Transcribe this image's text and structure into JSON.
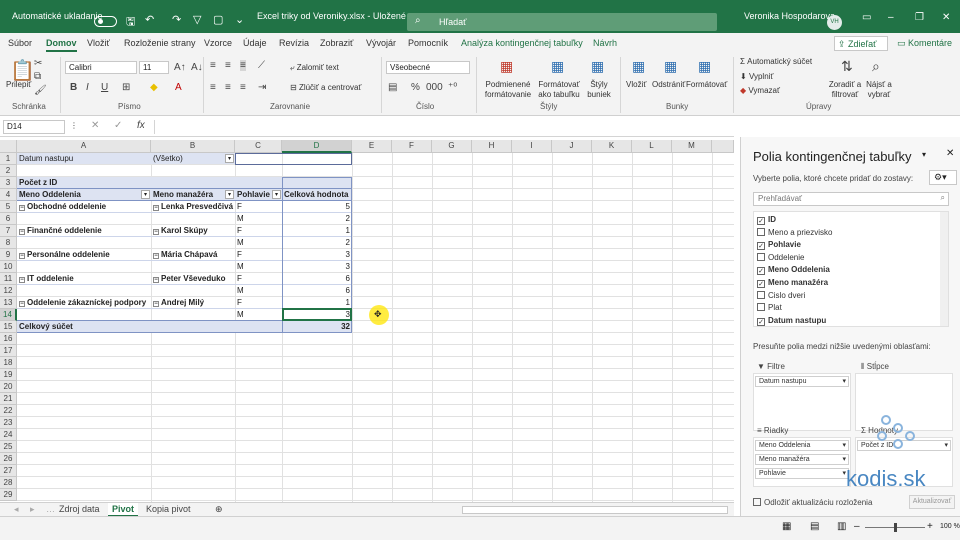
{
  "titlebar": {
    "autosave_label": "Automatické ukladanie",
    "filename": "Excel triky od Veroniky.xlsx  -  Uložené",
    "search_placeholder": "Hľadať",
    "user_name": "Veronika Hospodarova",
    "user_initials": "VH"
  },
  "ribbon_tabs": [
    "Súbor",
    "Domov",
    "Vložiť",
    "Rozloženie strany",
    "Vzorce",
    "Údaje",
    "Revízia",
    "Zobraziť",
    "Vývojár",
    "Pomocník",
    "Analýza kontingenčnej tabuľky",
    "Návrh"
  ],
  "share_label": "Zdieľať",
  "comments_label": "Komentáre",
  "ribbon": {
    "paste_label": "Prilepiť",
    "font_name": "Calibri",
    "font_size": "11",
    "wrap_text": "Zalomiť text",
    "merge_center": "Zlúčiť a centrovať",
    "number_format": "Všeobecné",
    "cond_format": "Podmienené formátovanie",
    "format_table": "Formátovať ako tabuľku",
    "cell_styles": "Štýly buniek",
    "insert": "Vložiť",
    "delete": "Odstrániť",
    "format": "Formátovať",
    "autosum": "Automatický súčet",
    "fill": "Vyplniť",
    "clear": "Vymazať",
    "sort_filter": "Zoradiť a filtrovať",
    "find_select": "Nájsť a vybrať",
    "groups": [
      "Schránka",
      "Písmo",
      "Zarovnanie",
      "Číslo",
      "Štýly",
      "Bunky",
      "Úpravy"
    ]
  },
  "namebox": "D14",
  "columns": [
    "A",
    "B",
    "C",
    "D",
    "E",
    "F",
    "G",
    "H",
    "I",
    "J",
    "K",
    "L",
    "M"
  ],
  "rows": [
    "1",
    "2",
    "3",
    "4",
    "5",
    "6",
    "7",
    "8",
    "9",
    "10",
    "11",
    "12",
    "13",
    "14",
    "15",
    "16",
    "17",
    "18",
    "19",
    "20",
    "21",
    "22",
    "23",
    "24",
    "25",
    "26",
    "27",
    "28",
    "29"
  ],
  "pivot": {
    "filter_label": "Datum nastupu",
    "filter_value": "(Všetko)",
    "measure_title": "Počet z ID",
    "headers": [
      "Meno Oddelenia",
      "Meno manažéra",
      "Pohlavie",
      "Celková hodnota"
    ],
    "rows": [
      {
        "dept": "Obchodné oddelenie",
        "manager": "Lenka Presvedčivá",
        "gender": "F",
        "value": "5"
      },
      {
        "dept": "",
        "manager": "",
        "gender": "M",
        "value": "2"
      },
      {
        "dept": "Finančné oddelenie",
        "manager": "Karol Skúpy",
        "gender": "F",
        "value": "1"
      },
      {
        "dept": "",
        "manager": "",
        "gender": "M",
        "value": "2"
      },
      {
        "dept": "Personálne oddelenie",
        "manager": "Mária Chápavá",
        "gender": "F",
        "value": "3"
      },
      {
        "dept": "",
        "manager": "",
        "gender": "M",
        "value": "3"
      },
      {
        "dept": "IT oddelenie",
        "manager": "Peter Vševeduko",
        "gender": "F",
        "value": "6"
      },
      {
        "dept": "",
        "manager": "",
        "gender": "M",
        "value": "6"
      },
      {
        "dept": "Oddelenie zákazníckej podpory",
        "manager": "Andrej Milý",
        "gender": "F",
        "value": "1"
      },
      {
        "dept": "",
        "manager": "",
        "gender": "M",
        "value": "3"
      }
    ],
    "total_label": "Celkový súčet",
    "total_value": "32"
  },
  "sheets": [
    "Zdroj data",
    "Pivot",
    "Kopia pivot"
  ],
  "pane": {
    "title": "Polia kontingenčnej tabuľky",
    "subtitle": "Vyberte polia, ktoré chcete pridať do zostavy:",
    "search_placeholder": "Prehľadávať",
    "fields": [
      {
        "label": "ID",
        "checked": true
      },
      {
        "label": "Meno a priezvisko",
        "checked": false
      },
      {
        "label": "Pohlavie",
        "checked": true
      },
      {
        "label": "Oddelenie",
        "checked": false
      },
      {
        "label": "Meno Oddelenia",
        "checked": true
      },
      {
        "label": "Meno manažéra",
        "checked": true
      },
      {
        "label": "Cislo dveri",
        "checked": false
      },
      {
        "label": "Plat",
        "checked": false
      },
      {
        "label": "Datum nastupu",
        "checked": true
      }
    ],
    "areas_hint": "Presuňte polia medzi nižšie uvedenými oblasťami:",
    "filters_label": "Filtre",
    "columns_label": "Stĺpce",
    "rows_label": "Riadky",
    "values_label": "Hodnoty",
    "filter_chip": "Datum nastupu",
    "row_chips": [
      "Meno Oddelenia",
      "Meno manažéra",
      "Pohlavie"
    ],
    "value_chip": "Počet z ID",
    "defer_label": "Odložiť aktualizáciu rozloženia",
    "update_label": "Aktualizovať"
  },
  "status": {
    "zoom": "100 %"
  },
  "watermark": "kodis.sk"
}
